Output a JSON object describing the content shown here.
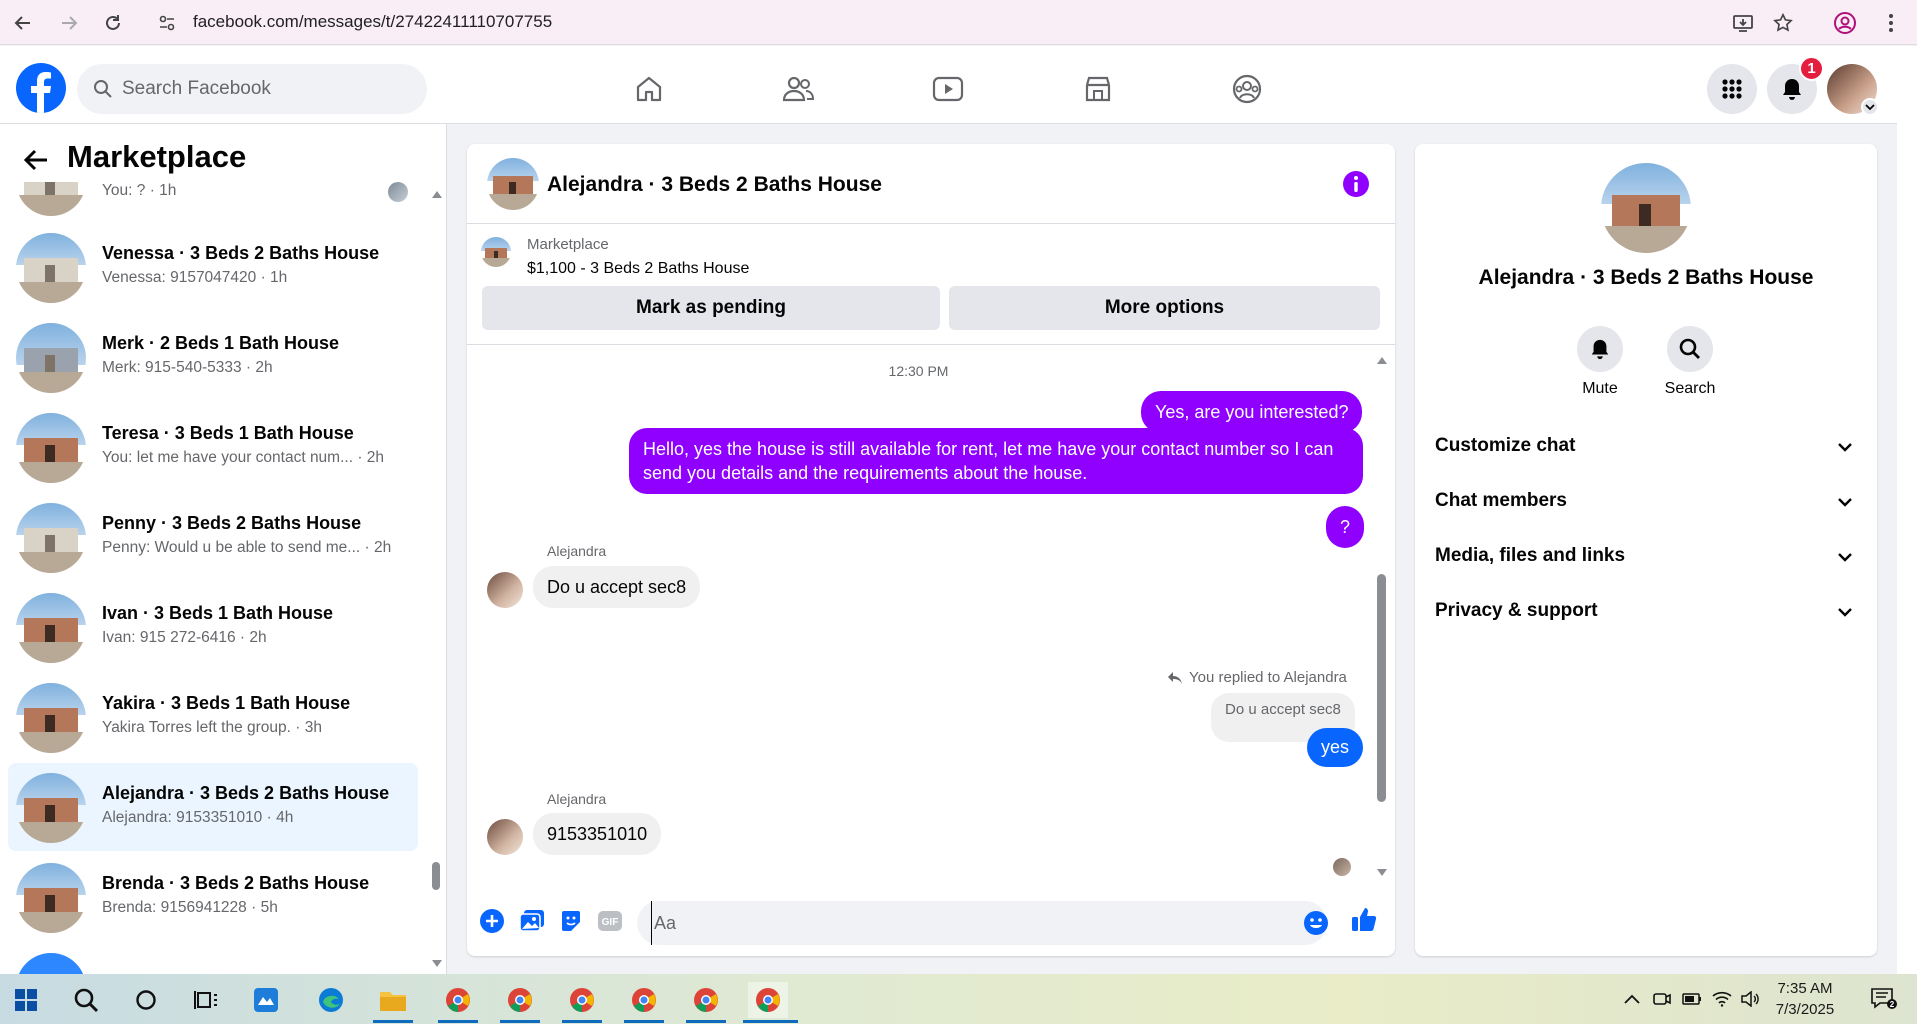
{
  "browser": {
    "url": "facebook.com/messages/t/27422411110707755"
  },
  "fb_nav": {
    "search_placeholder": "Search Facebook",
    "notification_count": "1"
  },
  "sidebar": {
    "title": "Marketplace",
    "conversations": [
      {
        "name": "",
        "preview": "You: ? · 1h",
        "thumb": "house-light"
      },
      {
        "name": "Venessa · 3 Beds 2 Baths House",
        "preview": "Venessa: 9157047420 · 1h",
        "thumb": "house-light"
      },
      {
        "name": "Merk · 2 Beds 1 Bath House",
        "preview": "Merk: 915-540-5333 · 2h",
        "thumb": "house-blue"
      },
      {
        "name": "Teresa · 3 Beds 1 Bath House",
        "preview": "You: let me have your contact num... · 2h",
        "thumb": "house-brick"
      },
      {
        "name": "Penny · 3 Beds 2 Baths House",
        "preview": "Penny: Would u be able to send me... · 2h",
        "thumb": "house-light"
      },
      {
        "name": "Ivan · 3 Beds 1 Bath House",
        "preview": "Ivan: 915 272-6416 · 2h",
        "thumb": "house-brick"
      },
      {
        "name": "Yakira · 3 Beds 1 Bath House",
        "preview": "Yakira Torres left the group. · 3h",
        "thumb": "house-brick"
      },
      {
        "name": "Alejandra · 3 Beds 2 Baths House",
        "preview": "Alejandra: 9153351010 · 4h",
        "thumb": "house-brick",
        "active": true
      },
      {
        "name": "Brenda · 3 Beds 2 Baths House",
        "preview": "Brenda: 9156941228 · 5h",
        "thumb": "house-brick"
      }
    ]
  },
  "chat": {
    "title": "Alejandra · 3 Beds 2 Baths House",
    "listing_label": "Marketplace",
    "listing_price": "$1,100 - 3 Beds 2 Baths House",
    "mark_pending_label": "Mark as pending",
    "more_options_label": "More options",
    "time_separator": "12:30 PM",
    "messages": {
      "out1": "Yes, are you interested?",
      "out2": "Hello, yes the house is still available for rent, let me have your contact number so I can send you details and the requirements about the house.",
      "out3": "?",
      "in1_sender": "Alejandra",
      "in1": "Do u accept sec8",
      "reply_note": "You replied to Alejandra",
      "quoted": "Do u accept sec8",
      "reply": "yes",
      "in2_sender": "Alejandra",
      "in2": "9153351010"
    },
    "composer_placeholder": "Aa",
    "gif_label": "GIF"
  },
  "info_panel": {
    "title": "Alejandra · 3 Beds 2 Baths House",
    "mute_label": "Mute",
    "search_label": "Search",
    "sections": [
      "Customize chat",
      "Chat members",
      "Media, files and links",
      "Privacy & support"
    ]
  },
  "taskbar": {
    "time": "7:35 AM",
    "date": "7/3/2025",
    "notification_count": "2"
  },
  "colors": {
    "fb_blue": "#0866ff",
    "chat_purple": "#8f00ff",
    "reply_blue": "#0866ff",
    "badge_red": "#e41e3f"
  }
}
